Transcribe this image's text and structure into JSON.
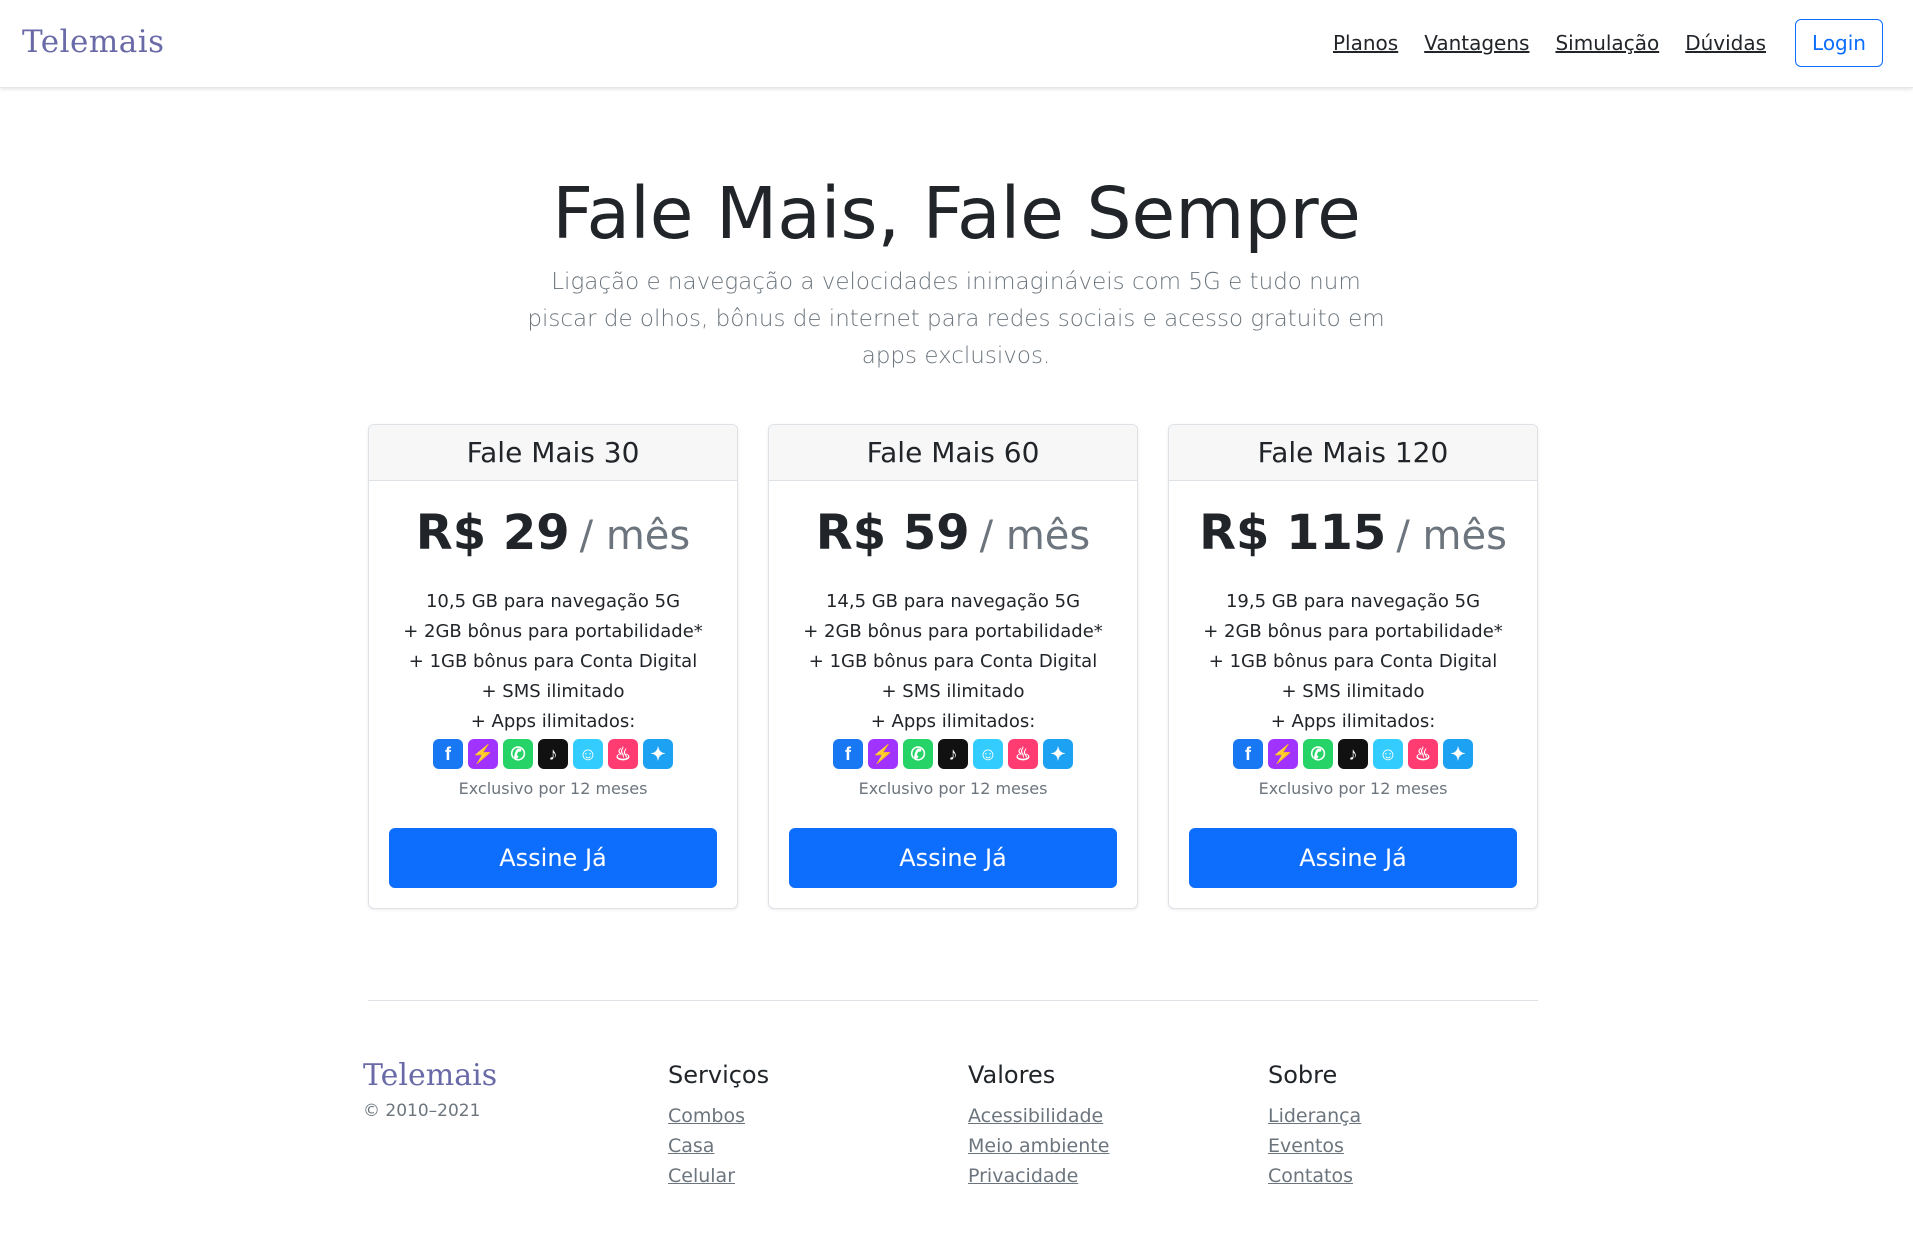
{
  "header": {
    "brand": "Telemais",
    "nav": [
      "Planos",
      "Vantagens",
      "Simulação",
      "Dúvidas"
    ],
    "login_label": "Login"
  },
  "hero": {
    "title": "Fale Mais, Fale Sempre",
    "subtitle": "Ligação e navegação a velocidades inimagináveis com 5G e tudo num piscar de olhos, bônus de internet para redes sociais e acesso gratuito em apps exclusivos."
  },
  "plans": [
    {
      "name": "Fale Mais 30",
      "price": "R$ 29",
      "period": "/ mês",
      "features": [
        "10,5 GB para navegação 5G",
        "+ 2GB bônus para portabilidade*",
        "+ 1GB bônus para Conta Digital",
        "+ SMS ilimitado",
        "+ Apps ilimitados:"
      ],
      "note": "Exclusivo por 12 meses",
      "cta": "Assine Já"
    },
    {
      "name": "Fale Mais 60",
      "price": "R$ 59",
      "period": "/ mês",
      "features": [
        "14,5 GB para navegação 5G",
        "+ 2GB bônus para portabilidade*",
        "+ 1GB bônus para Conta Digital",
        "+ SMS ilimitado",
        "+ Apps ilimitados:"
      ],
      "note": "Exclusivo por 12 meses",
      "cta": "Assine Já"
    },
    {
      "name": "Fale Mais 120",
      "price": "R$ 115",
      "period": "/ mês",
      "features": [
        "19,5 GB para navegação 5G",
        "+ 2GB bônus para portabilidade*",
        "+ 1GB bônus para Conta Digital",
        "+ SMS ilimitado",
        "+ Apps ilimitados:"
      ],
      "note": "Exclusivo por 12 meses",
      "cta": "Assine Já"
    }
  ],
  "app_icons": [
    {
      "name": "facebook-icon",
      "color": "#1877f2"
    },
    {
      "name": "messenger-icon",
      "color": "#a033ff"
    },
    {
      "name": "whatsapp-icon",
      "color": "#25d366"
    },
    {
      "name": "tiktok-icon",
      "color": "#111111"
    },
    {
      "name": "waze-icon",
      "color": "#33ccff"
    },
    {
      "name": "tinder-icon",
      "color": "#fe3c72"
    },
    {
      "name": "twitter-icon",
      "color": "#1da1f2"
    }
  ],
  "footer": {
    "brand": "Telemais",
    "copyright": "© 2010–2021",
    "columns": [
      {
        "title": "Serviços",
        "links": [
          "Combos",
          "Casa",
          "Celular"
        ]
      },
      {
        "title": "Valores",
        "links": [
          "Acessibilidade",
          "Meio ambiente",
          "Privacidade"
        ]
      },
      {
        "title": "Sobre",
        "links": [
          "Liderança",
          "Eventos",
          "Contatos"
        ]
      }
    ]
  },
  "colors": {
    "primary": "#0d6efd",
    "brand": "#6a6aa8",
    "muted": "#6c757d"
  }
}
